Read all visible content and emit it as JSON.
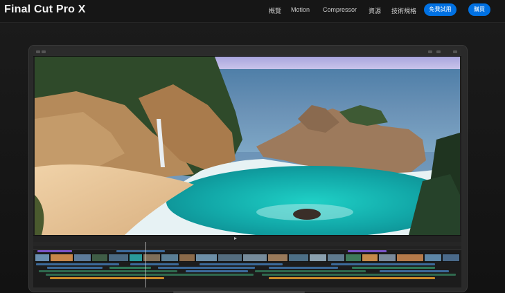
{
  "nav": {
    "brand": "Final Cut Pro X",
    "links": [
      "概覽",
      "Motion",
      "Compressor",
      "資源",
      "技術規格"
    ],
    "trial_button": "免費試用",
    "buy_button": "購買"
  },
  "colors": {
    "accent": "#0071e3",
    "nav_background": "#161616",
    "timeline_blue": "#3c6a9a",
    "timeline_purple": "#7a54c8",
    "timeline_green": "#2f7a5a",
    "timeline_orange": "#c98a2a"
  },
  "icons": [
    "play-icon",
    "toolbar-icon"
  ],
  "viewer": {
    "scene": "coastal waterfall cove with turquoise water"
  }
}
